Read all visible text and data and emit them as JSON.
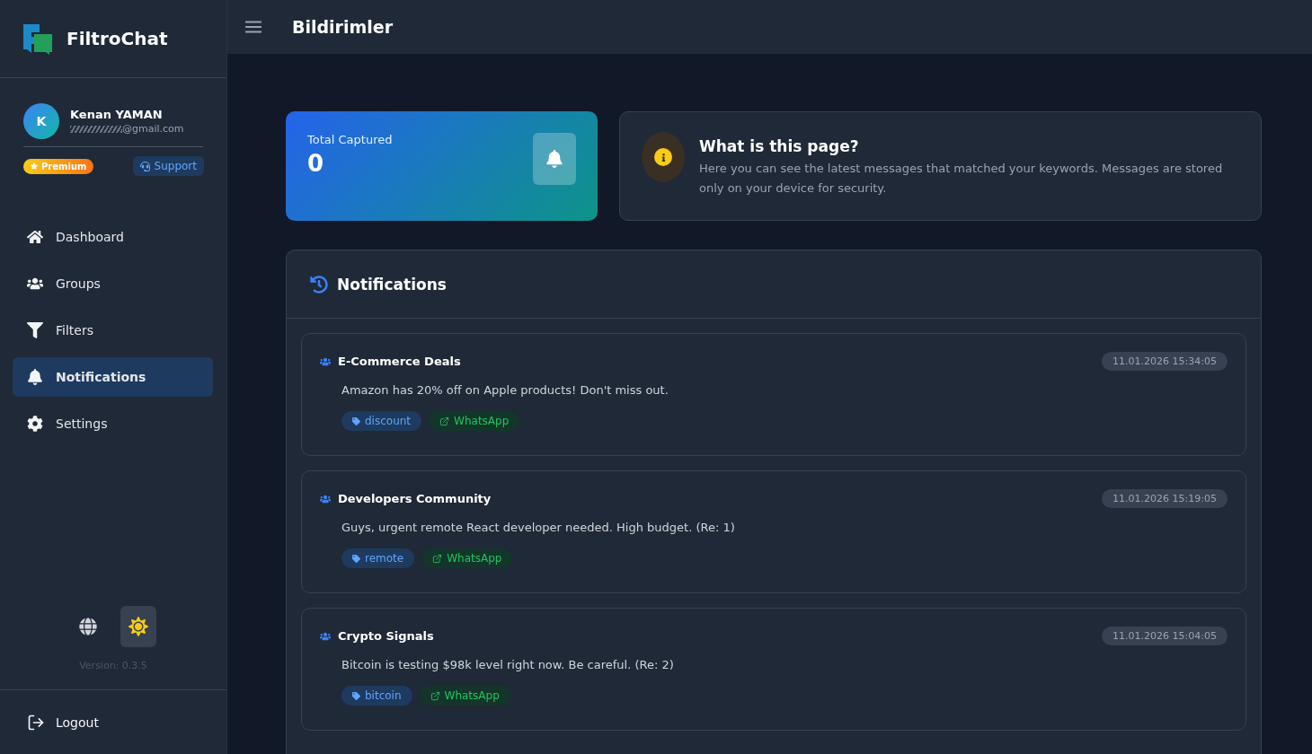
{
  "brand": {
    "name": "FiltroChat"
  },
  "header": {
    "title": "Bildirimler"
  },
  "user": {
    "initial": "K",
    "name": "Kenan YAMAN",
    "email": "@gmail.com",
    "plan": "Premium",
    "support": "Support"
  },
  "nav": [
    {
      "label": "Dashboard",
      "selected": false
    },
    {
      "label": "Groups",
      "selected": false
    },
    {
      "label": "Filters",
      "selected": false
    },
    {
      "label": "Notifications",
      "selected": true
    },
    {
      "label": "Settings",
      "selected": false
    }
  ],
  "version": "Version: 0.3.5",
  "logout": "Logout",
  "stat": {
    "label": "Total Captured",
    "value": "0"
  },
  "info": {
    "title": "What is this page?",
    "text": "Here you can see the latest messages that matched your keywords. Messages are stored only on your device for security."
  },
  "panel": {
    "title": "Notifications"
  },
  "notifications": [
    {
      "group": "E-Commerce Deals",
      "time": "11.01.2026 15:34:05",
      "message": "Amazon has 20% off on Apple products! Don't miss out.",
      "tags": [
        {
          "kind": "keyword",
          "label": "discount"
        },
        {
          "kind": "source",
          "label": "WhatsApp"
        }
      ]
    },
    {
      "group": "Developers Community",
      "time": "11.01.2026 15:19:05",
      "message": "Guys, urgent remote React developer needed. High budget. (Re: 1)",
      "tags": [
        {
          "kind": "keyword",
          "label": "remote"
        },
        {
          "kind": "source",
          "label": "WhatsApp"
        }
      ]
    },
    {
      "group": "Crypto Signals",
      "time": "11.01.2026 15:04:05",
      "message": "Bitcoin is testing $98k level right now. Be careful. (Re: 2)",
      "tags": [
        {
          "kind": "keyword",
          "label": "bitcoin"
        },
        {
          "kind": "source",
          "label": "WhatsApp"
        }
      ]
    }
  ]
}
